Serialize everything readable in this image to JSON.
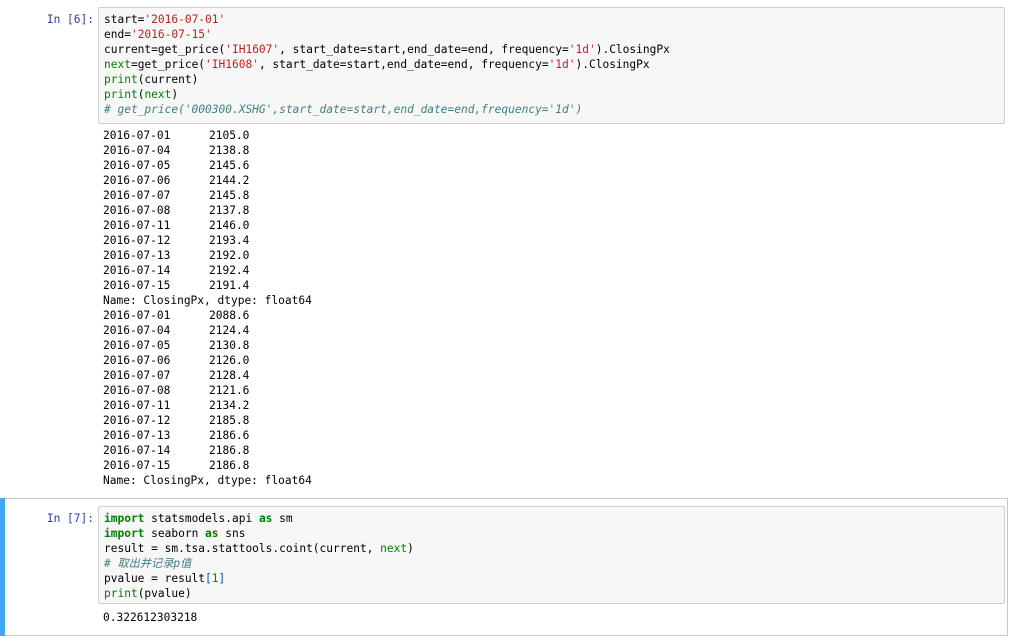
{
  "cell6": {
    "prompt": "In [6]:",
    "code": [
      [
        {
          "t": "start=",
          "c": ""
        },
        {
          "t": "'2016-07-01'",
          "c": "str"
        }
      ],
      [
        {
          "t": "end=",
          "c": ""
        },
        {
          "t": "'2016-07-15'",
          "c": "str"
        }
      ],
      [
        {
          "t": "current=get_price(",
          "c": ""
        },
        {
          "t": "'IH1607'",
          "c": "str"
        },
        {
          "t": ", start_date=start,end_date=end, frequency=",
          "c": ""
        },
        {
          "t": "'1d'",
          "c": "str"
        },
        {
          "t": ").ClosingPx",
          "c": ""
        }
      ],
      [
        {
          "t": "next",
          "c": "bi"
        },
        {
          "t": "=get_price(",
          "c": ""
        },
        {
          "t": "'IH1608'",
          "c": "str"
        },
        {
          "t": ", start_date=start,end_date=end, frequency=",
          "c": ""
        },
        {
          "t": "'1d'",
          "c": "str"
        },
        {
          "t": ").ClosingPx",
          "c": ""
        }
      ],
      [
        {
          "t": "print",
          "c": "bi"
        },
        {
          "t": "(current)",
          "c": ""
        }
      ],
      [
        {
          "t": "print",
          "c": "bi"
        },
        {
          "t": "(",
          "c": ""
        },
        {
          "t": "next",
          "c": "bi"
        },
        {
          "t": ")",
          "c": ""
        }
      ],
      [
        {
          "t": "# get_price('000300.XSHG',start_date=start,end_date=end,frequency='1d')",
          "c": "cm"
        }
      ]
    ],
    "output_series": [
      {
        "rows": [
          [
            "2016-07-01",
            "2105.0"
          ],
          [
            "2016-07-04",
            "2138.8"
          ],
          [
            "2016-07-05",
            "2145.6"
          ],
          [
            "2016-07-06",
            "2144.2"
          ],
          [
            "2016-07-07",
            "2145.8"
          ],
          [
            "2016-07-08",
            "2137.8"
          ],
          [
            "2016-07-11",
            "2146.0"
          ],
          [
            "2016-07-12",
            "2193.4"
          ],
          [
            "2016-07-13",
            "2192.0"
          ],
          [
            "2016-07-14",
            "2192.4"
          ],
          [
            "2016-07-15",
            "2191.4"
          ]
        ],
        "footer": "Name: ClosingPx, dtype: float64"
      },
      {
        "rows": [
          [
            "2016-07-01",
            "2088.6"
          ],
          [
            "2016-07-04",
            "2124.4"
          ],
          [
            "2016-07-05",
            "2130.8"
          ],
          [
            "2016-07-06",
            "2126.0"
          ],
          [
            "2016-07-07",
            "2128.4"
          ],
          [
            "2016-07-08",
            "2121.6"
          ],
          [
            "2016-07-11",
            "2134.2"
          ],
          [
            "2016-07-12",
            "2185.8"
          ],
          [
            "2016-07-13",
            "2186.6"
          ],
          [
            "2016-07-14",
            "2186.8"
          ],
          [
            "2016-07-15",
            "2186.8"
          ]
        ],
        "footer": "Name: ClosingPx, dtype: float64"
      }
    ]
  },
  "cell7": {
    "prompt": "In [7]:",
    "code": [
      [
        {
          "t": "import",
          "c": "kw"
        },
        {
          "t": " statsmodels.api ",
          "c": ""
        },
        {
          "t": "as",
          "c": "kw"
        },
        {
          "t": " sm",
          "c": ""
        }
      ],
      [
        {
          "t": "import",
          "c": "kw"
        },
        {
          "t": " seaborn ",
          "c": ""
        },
        {
          "t": "as",
          "c": "kw"
        },
        {
          "t": " sns",
          "c": ""
        }
      ],
      [
        {
          "t": "result = sm.tsa.stattools.coint(current, ",
          "c": ""
        },
        {
          "t": "next",
          "c": "bi"
        },
        {
          "t": ")",
          "c": ""
        }
      ],
      [
        {
          "t": "# 取出并记录p值",
          "c": "cm"
        }
      ],
      [
        {
          "t": "pvalue = result",
          "c": ""
        },
        {
          "t": "[",
          "c": "br"
        },
        {
          "t": "1",
          "c": "num"
        },
        {
          "t": "]",
          "c": "br"
        }
      ],
      [
        {
          "t": "print",
          "c": "bi"
        },
        {
          "t": "(pvalue)",
          "c": ""
        }
      ]
    ],
    "output": "0.322612303218"
  }
}
